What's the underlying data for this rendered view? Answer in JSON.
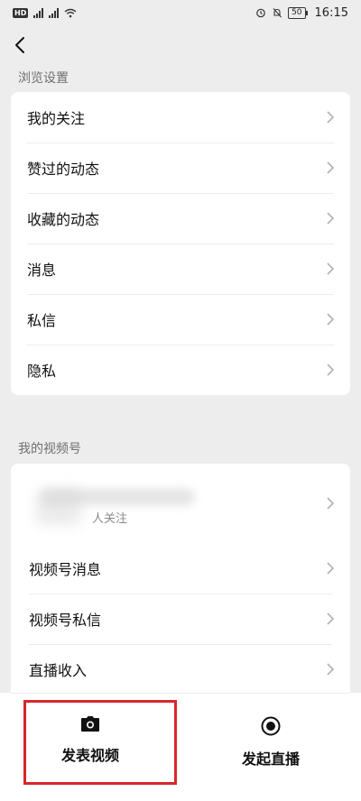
{
  "status_bar": {
    "hd_badge": "HD",
    "network_1": "4G",
    "network_2": "4G",
    "battery": "50",
    "time": "16:15"
  },
  "nav": {
    "back_icon": "chevron-left-icon"
  },
  "browse_section": {
    "label": "浏览设置",
    "items": [
      {
        "label": "我的关注"
      },
      {
        "label": "赞过的动态"
      },
      {
        "label": "收藏的动态"
      },
      {
        "label": "消息"
      },
      {
        "label": "私信"
      },
      {
        "label": "隐私"
      }
    ]
  },
  "channels_section": {
    "label": "我的视频号",
    "profile": {
      "followers_text": "人关注"
    },
    "items": [
      {
        "label": "视频号消息"
      },
      {
        "label": "视频号私信"
      },
      {
        "label": "直播收入"
      }
    ]
  },
  "bottom_actions": {
    "post_video": {
      "label": "发表视频",
      "icon": "camera-icon"
    },
    "start_live": {
      "label": "发起直播",
      "icon": "record-icon"
    }
  },
  "colors": {
    "background": "#ededed",
    "card": "#ffffff",
    "highlight": "#d9262b"
  }
}
